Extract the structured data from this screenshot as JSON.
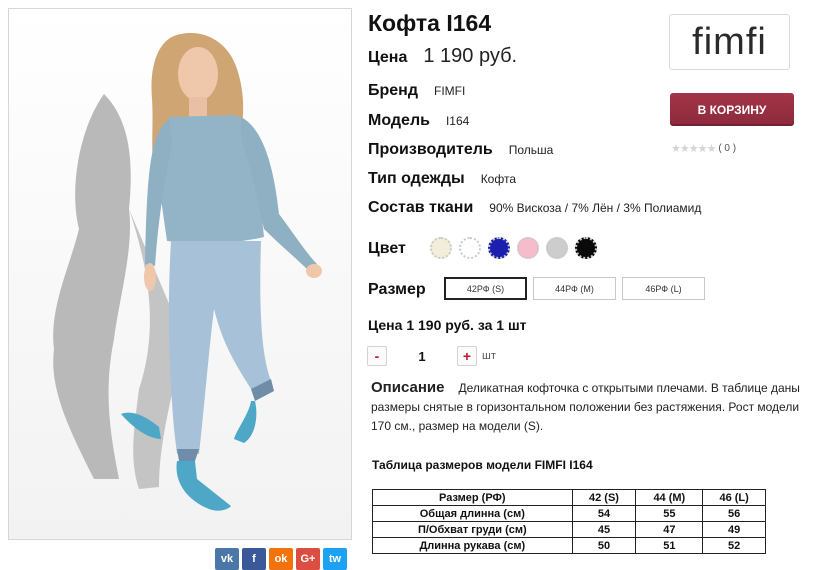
{
  "colors": {
    "cart_button": "#8b2a3c",
    "accent_red": "#c0182c",
    "swatches": [
      "#f3eedc",
      "#ffffff",
      "#1a1fb0",
      "#f5bccb",
      "#cdcdcd",
      "#0a0a0a"
    ]
  },
  "product": {
    "title": "Кофта I164",
    "price_label": "Цена",
    "price_value": "1 190 руб.",
    "brand_label": "Бренд",
    "brand_value": "FIMFI",
    "model_label": "Модель",
    "model_value": "I164",
    "maker_label": "Производитель",
    "maker_value": "Польша",
    "type_label": "Тип одежды",
    "type_value": "Кофта",
    "fabric_label": "Состав ткани",
    "fabric_value": "90% Вискоза / 7% Лён / 3% Полиамид",
    "color_label": "Цвет",
    "size_label": "Размер",
    "sizes": [
      "42РФ (S)",
      "44РФ (M)",
      "46РФ (L)"
    ],
    "total_line": "Цена 1 190 руб. за 1 шт"
  },
  "logo": {
    "text": "fimfi"
  },
  "cart": {
    "label": "В КОРЗИНУ"
  },
  "rating": {
    "stars": "★★★★★",
    "count": "( 0 )"
  },
  "quantity": {
    "minus": "-",
    "value": "1",
    "plus": "+",
    "unit": "шт"
  },
  "description": {
    "title": "Описание",
    "text": "Деликатная кофточка с открытыми плечами. В таблице даны размеры снятые в горизонтальном положении без растяжения. Рост модели 170 см., размер на модели (S)."
  },
  "size_table": {
    "title": "Таблица размеров модели FIMFI  I164",
    "headers": [
      "Размер (РФ)",
      "42 (S)",
      "44 (M)",
      "46 (L)"
    ],
    "rows": [
      [
        "Общая длинна (см)",
        "54",
        "55",
        "56"
      ],
      [
        "П/Обхват груди (см)",
        "45",
        "47",
        "49"
      ],
      [
        "Длинна рукава (см)",
        "50",
        "51",
        "52"
      ]
    ]
  },
  "social": [
    {
      "icon": "vk-icon",
      "glyph": "vk",
      "color": "#4a76a8"
    },
    {
      "icon": "facebook-icon",
      "glyph": "f",
      "color": "#3b5998"
    },
    {
      "icon": "odnoklassniki-icon",
      "glyph": "ok",
      "color": "#f2720c"
    },
    {
      "icon": "google-plus-icon",
      "glyph": "G+",
      "color": "#dc4e41"
    },
    {
      "icon": "twitter-icon",
      "glyph": "tw",
      "color": "#1da1f2"
    }
  ]
}
